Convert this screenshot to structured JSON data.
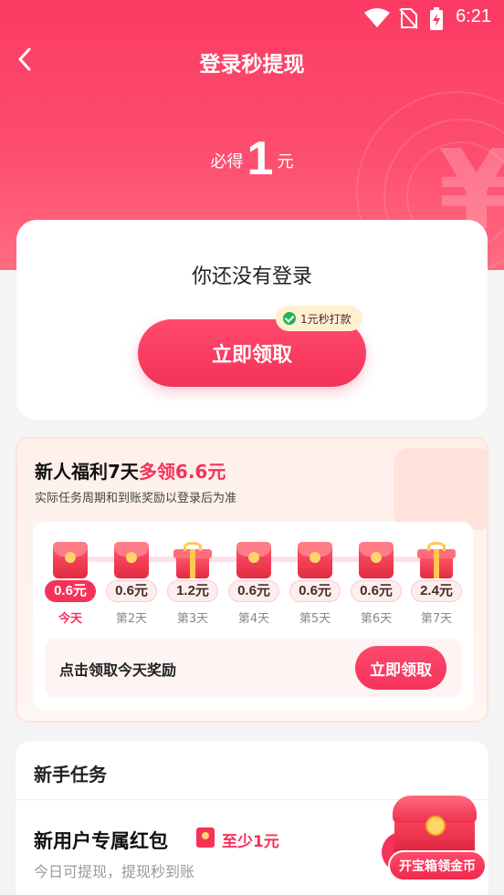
{
  "status_bar": {
    "time": "6:21"
  },
  "header": {
    "title": "登录秒提现"
  },
  "hero": {
    "prefix": "必得",
    "amount": "1",
    "unit": "元"
  },
  "login_card": {
    "message": "你还没有登录",
    "button_label": "立即领取",
    "tag": "1元秒打款"
  },
  "welfare": {
    "title_main": "新人福利7天",
    "title_highlight": "多领6.6元",
    "subtitle": "实际任务周期和到账奖励以登录后为准",
    "days": [
      {
        "amount": "0.6元",
        "label": "今天",
        "icon": "red-envelope-icon",
        "active": true
      },
      {
        "amount": "0.6元",
        "label": "第2天",
        "icon": "red-envelope-icon",
        "active": false
      },
      {
        "amount": "1.2元",
        "label": "第3天",
        "icon": "gift-box-icon",
        "active": false
      },
      {
        "amount": "0.6元",
        "label": "第4天",
        "icon": "red-envelope-icon",
        "active": false
      },
      {
        "amount": "0.6元",
        "label": "第5天",
        "icon": "red-envelope-icon",
        "active": false
      },
      {
        "amount": "0.6元",
        "label": "第6天",
        "icon": "red-envelope-icon",
        "active": false
      },
      {
        "amount": "2.4元",
        "label": "第7天",
        "icon": "gift-box-icon",
        "active": false
      }
    ],
    "claim_text": "点击领取今天奖励",
    "claim_button": "立即领取"
  },
  "tasks": {
    "title": "新手任务",
    "item": {
      "name": "新用户专属红包",
      "reward": "至少1元",
      "desc": "今日可提现，提现秒到账"
    }
  },
  "floating": {
    "label": "开宝箱领金币"
  },
  "colors": {
    "primary": "#f5325a",
    "hero": "#fb3a63",
    "highlight_bg": "#fff1cf"
  }
}
